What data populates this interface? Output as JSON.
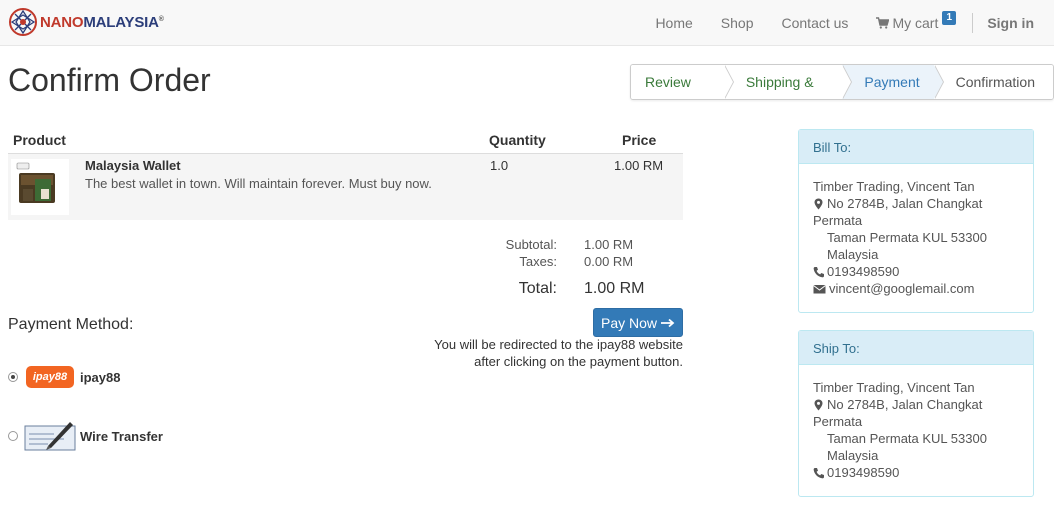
{
  "brand": {
    "logo_part1": "NANO",
    "logo_part2": "MALAYSIA",
    "trademark": "®"
  },
  "nav": {
    "items": [
      {
        "label": "Home"
      },
      {
        "label": "Shop"
      },
      {
        "label": "Contact us"
      }
    ],
    "cart_label": "My cart",
    "cart_count": "1",
    "signin_label": "Sign in"
  },
  "page": {
    "title": "Confirm Order"
  },
  "steps": [
    {
      "label": "Review Order",
      "state": "done"
    },
    {
      "label": "Shipping & Billing",
      "state": "done"
    },
    {
      "label": "Payment",
      "state": "active"
    },
    {
      "label": "Confirmation",
      "state": "pending"
    }
  ],
  "table": {
    "headers": {
      "product": "Product",
      "quantity": "Quantity",
      "price": "Price"
    },
    "rows": [
      {
        "name": "Malaysia Wallet",
        "description": "The best wallet in town. Will maintain forever. Must buy now.",
        "quantity": "1.0",
        "price": "1.00 RM"
      }
    ]
  },
  "totals": {
    "subtotal_label": "Subtotal:",
    "subtotal": "1.00 RM",
    "taxes_label": "Taxes:",
    "taxes": "0.00 RM",
    "total_label": "Total:",
    "total": "1.00 RM"
  },
  "payment": {
    "title": "Payment Method:",
    "pay_button": "Pay Now",
    "redirect_note_line1": "You will be redirected to the ipay88 website",
    "redirect_note_line2": "after clicking on the payment button.",
    "methods": [
      {
        "label": "ipay88",
        "logo_text": "ipay88",
        "selected": true
      },
      {
        "label": "Wire Transfer",
        "selected": false
      }
    ]
  },
  "bill_to": {
    "title": "Bill To:",
    "name": "Timber Trading, Vincent Tan",
    "street": "No 2784B, Jalan Changkat",
    "street2": "Permata",
    "city": "Taman Permata KUL 53300",
    "country": "Malaysia",
    "phone": "0193498590",
    "email": "vincent@googlemail.com"
  },
  "ship_to": {
    "title": "Ship To:",
    "name": "Timber Trading, Vincent Tan",
    "street": "No 2784B, Jalan Changkat",
    "street2": "Permata",
    "city": "Taman Permata KUL 53300",
    "country": "Malaysia",
    "phone": "0193498590"
  },
  "colors": {
    "primary": "#337ab7",
    "step_done": "#3a7a3a",
    "panel_head": "#d9edf7",
    "ipay_orange": "#f26522"
  }
}
